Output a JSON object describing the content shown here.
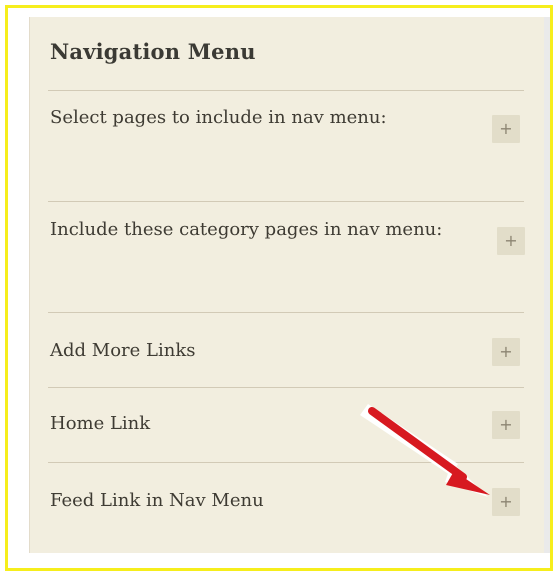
{
  "panel": {
    "title": "Navigation Menu",
    "expand_symbol": "+",
    "items": [
      {
        "label": "Select pages to include in nav menu:"
      },
      {
        "label": "Include these category pages in nav menu:"
      },
      {
        "label": "Add More Links"
      },
      {
        "label": "Home Link"
      },
      {
        "label": "Feed Link in Nav Menu"
      }
    ]
  },
  "annotation": {
    "arrow_icon": "red-arrow-icon",
    "arrow_color": "#d71920"
  },
  "colors": {
    "frame_border": "#f6ee1c",
    "panel_background": "#f2eedf",
    "button_background": "#e2ddc9"
  }
}
